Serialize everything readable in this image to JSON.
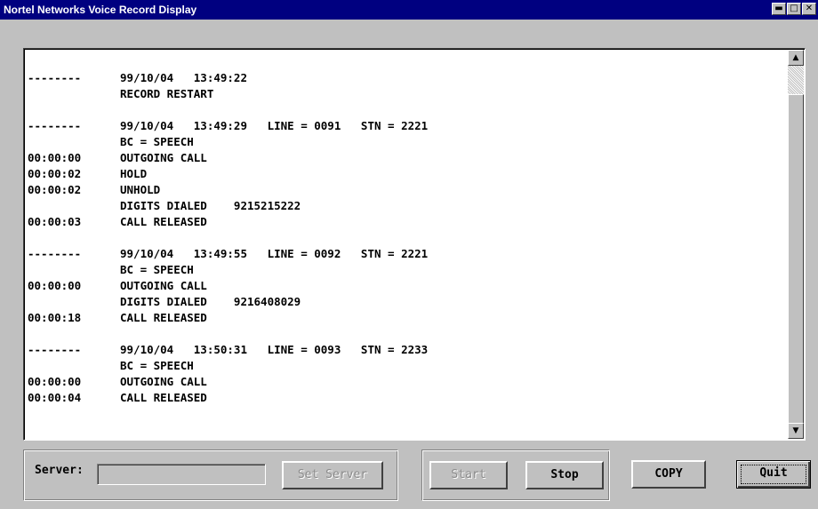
{
  "window": {
    "title": "Nortel Networks Voice Record Display",
    "controls": {
      "minimize": "minimize-icon",
      "maximize": "maximize-icon",
      "close": "close-icon"
    }
  },
  "log": {
    "lines": [
      {
        "ts": "--------",
        "text": "99/10/04   13:49:22"
      },
      {
        "ts": "",
        "text": "RECORD RESTART"
      },
      {
        "ts": null,
        "text": null
      },
      {
        "ts": "--------",
        "text": "99/10/04   13:49:29   LINE = 0091   STN = 2221"
      },
      {
        "ts": "",
        "text": "BC = SPEECH"
      },
      {
        "ts": "00:00:00",
        "text": "OUTGOING CALL"
      },
      {
        "ts": "00:00:02",
        "text": "HOLD"
      },
      {
        "ts": "00:00:02",
        "text": "UNHOLD"
      },
      {
        "ts": "",
        "text": "DIGITS DIALED    9215215222"
      },
      {
        "ts": "00:00:03",
        "text": "CALL RELEASED"
      },
      {
        "ts": null,
        "text": null
      },
      {
        "ts": "--------",
        "text": "99/10/04   13:49:55   LINE = 0092   STN = 2221"
      },
      {
        "ts": "",
        "text": "BC = SPEECH"
      },
      {
        "ts": "00:00:00",
        "text": "OUTGOING CALL"
      },
      {
        "ts": "",
        "text": "DIGITS DIALED    9216408029"
      },
      {
        "ts": "00:00:18",
        "text": "CALL RELEASED"
      },
      {
        "ts": null,
        "text": null
      },
      {
        "ts": "--------",
        "text": "99/10/04   13:50:31   LINE = 0093   STN = 2233"
      },
      {
        "ts": "",
        "text": "BC = SPEECH"
      },
      {
        "ts": "00:00:00",
        "text": "OUTGOING CALL"
      },
      {
        "ts": "00:00:04",
        "text": "CALL RELEASED"
      }
    ]
  },
  "controls": {
    "server_label": "Server:",
    "server_value": "",
    "set_server": "Set Server",
    "start": "Start",
    "stop": "Stop",
    "copy": "COPY",
    "quit": "Quit"
  }
}
